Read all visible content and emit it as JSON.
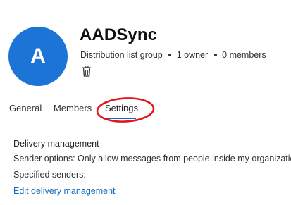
{
  "group": {
    "avatar_initial": "A",
    "avatar_color": "#1b74d6",
    "name": "AADSync",
    "type": "Distribution list group",
    "owners": "1 owner",
    "members": "0 members",
    "delete_icon": "trash-icon"
  },
  "tabs": [
    {
      "label": "General",
      "selected": false
    },
    {
      "label": "Members",
      "selected": false
    },
    {
      "label": "Settings",
      "selected": true
    }
  ],
  "annotation": {
    "shape": "ellipse",
    "color": "#e3141c",
    "target": "Settings"
  },
  "delivery": {
    "title": "Delivery management",
    "sender_options": "Sender options: Only allow messages from people inside my organization",
    "specified_senders": "Specified senders:",
    "edit_link": "Edit delivery management"
  },
  "colors": {
    "accent": "#0f6cbd"
  }
}
